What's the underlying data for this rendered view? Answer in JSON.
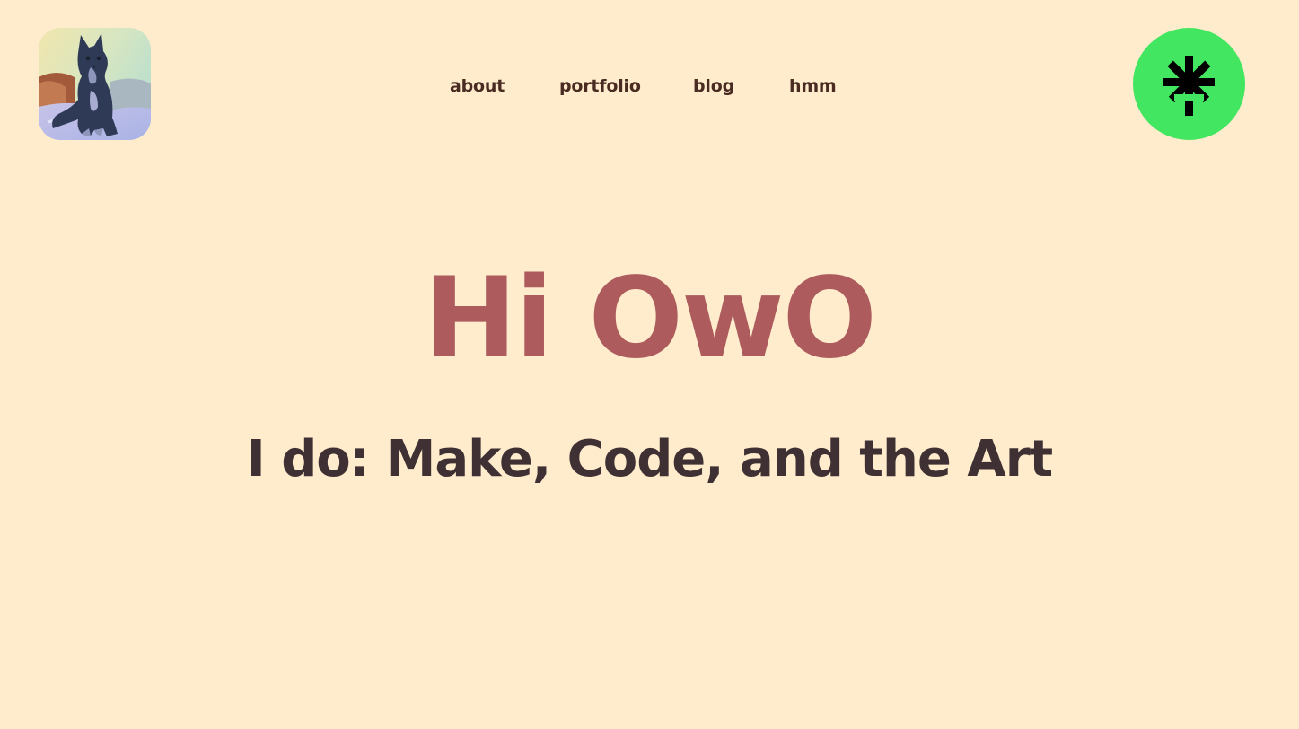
{
  "header": {
    "avatar_icon": "wolf-avatar-icon",
    "nav": [
      {
        "label": "about"
      },
      {
        "label": "portfolio"
      },
      {
        "label": "blog"
      },
      {
        "label": "hmm"
      }
    ],
    "linktree_icon": "linktree-asterisk-icon"
  },
  "hero": {
    "title": "Hi OwO",
    "subtitle": "I do: Make, Code, and the Art"
  },
  "colors": {
    "background": "#ffeccd",
    "title": "#ad5b5d",
    "subtitle": "#3f3133",
    "nav_text": "#4a2b22",
    "linktree_green": "#43e660"
  }
}
